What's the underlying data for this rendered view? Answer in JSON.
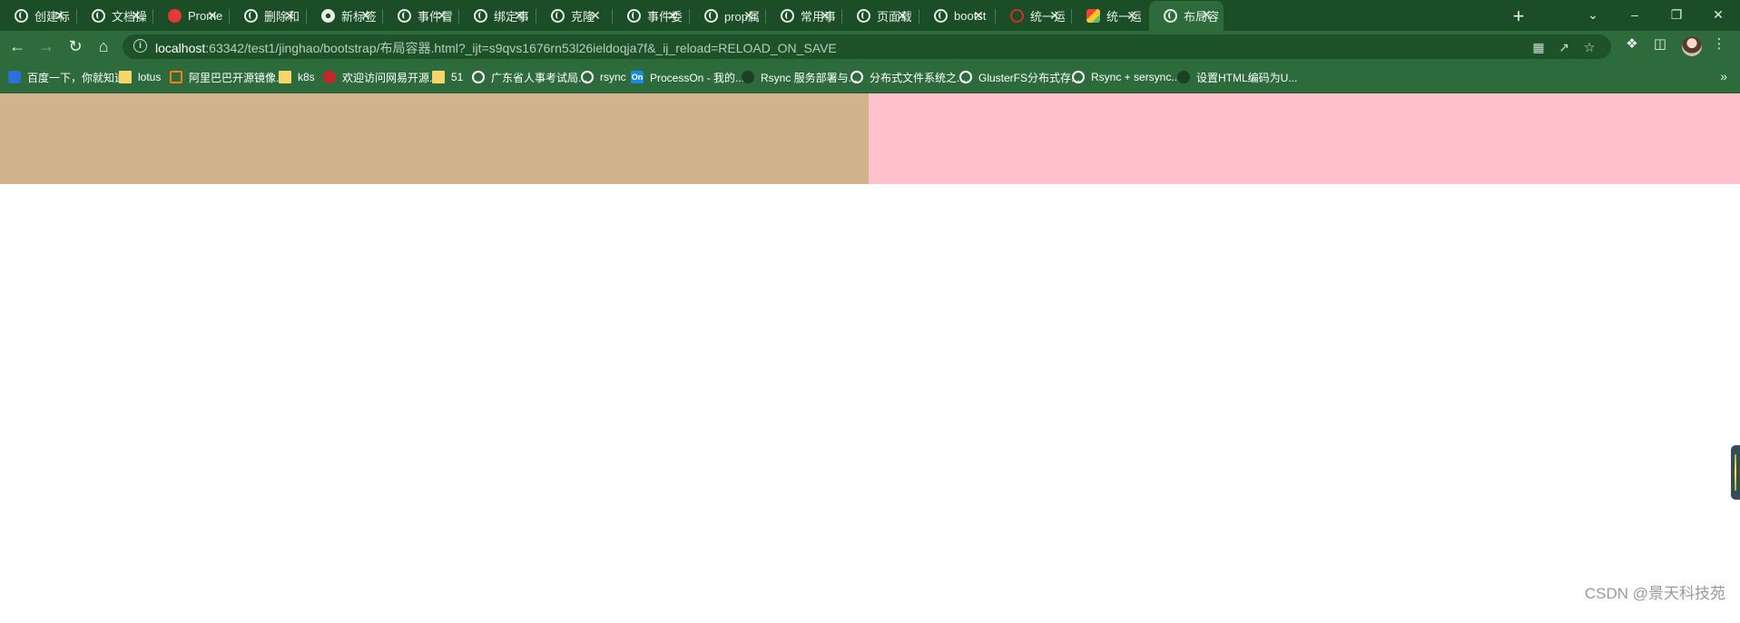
{
  "tabs": [
    {
      "title": "创建标",
      "favicon": "globe-icon"
    },
    {
      "title": "文档操",
      "favicon": "globe-icon"
    },
    {
      "title": "Prome",
      "favicon": "prometheus-icon"
    },
    {
      "title": "删除和",
      "favicon": "globe-icon"
    },
    {
      "title": "新标签",
      "favicon": "chrome-icon"
    },
    {
      "title": "事件冒",
      "favicon": "globe-icon"
    },
    {
      "title": "绑定事",
      "favicon": "globe-icon"
    },
    {
      "title": "克隆",
      "favicon": "globe-icon"
    },
    {
      "title": "事件委",
      "favicon": "globe-icon"
    },
    {
      "title": "prop属",
      "favicon": "globe-icon"
    },
    {
      "title": "常用事",
      "favicon": "globe-icon"
    },
    {
      "title": "页面载",
      "favicon": "globe-icon"
    },
    {
      "title": "bootst",
      "favicon": "globe-icon"
    },
    {
      "title": "统一运",
      "favicon": "ring-icon"
    },
    {
      "title": "统一运",
      "favicon": "multicolor-icon"
    },
    {
      "title": "布局容",
      "favicon": "globe-icon",
      "active": true
    }
  ],
  "address_bar": {
    "host": "localhost",
    "rest": ":63342/test1/jinghao/bootstrap/布局容器.html?_ijt=s9qvs1676rn53l26ieldoqja7f&_ij_reload=RELOAD_ON_SAVE"
  },
  "bookmarks": [
    {
      "label": "百度一下，你就知道",
      "icon": "paw-icon"
    },
    {
      "label": "lotus",
      "icon": "folder-icon"
    },
    {
      "label": "阿里巴巴开源镜像...",
      "icon": "alibaba-icon"
    },
    {
      "label": "k8s",
      "icon": "folder-icon"
    },
    {
      "label": "欢迎访问网易开源...",
      "icon": "netease-icon"
    },
    {
      "label": "51",
      "icon": "folder-icon"
    },
    {
      "label": "广东省人事考试局...",
      "icon": "globe-icon"
    },
    {
      "label": "rsync",
      "icon": "globe-icon"
    },
    {
      "label": "ProcessOn - 我的...",
      "icon": "processon-icon"
    },
    {
      "label": "Rsync 服务部署与...",
      "icon": "gear-icon"
    },
    {
      "label": "分布式文件系统之...",
      "icon": "globe-icon"
    },
    {
      "label": "GlusterFS分布式存...",
      "icon": "globe-icon"
    },
    {
      "label": "Rsync + sersync...",
      "icon": "globe-icon"
    },
    {
      "label": "设置HTML编码为U...",
      "icon": "gear-icon"
    }
  ],
  "processon_badge": "On",
  "colors": {
    "left_column": "#d2b48c",
    "right_column": "#ffc0cb"
  },
  "watermark": "CSDN @景天科技苑"
}
